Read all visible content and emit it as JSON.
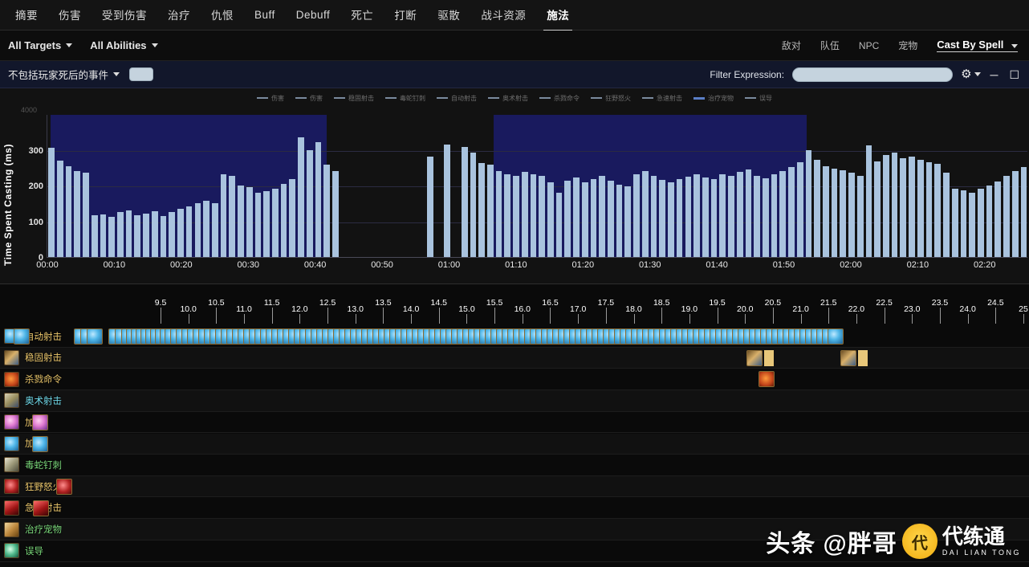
{
  "tabs": [
    {
      "label": "摘要",
      "active": false
    },
    {
      "label": "伤害",
      "active": false
    },
    {
      "label": "受到伤害",
      "active": false
    },
    {
      "label": "治疗",
      "active": false
    },
    {
      "label": "仇恨",
      "active": false
    },
    {
      "label": "Buff",
      "active": false
    },
    {
      "label": "Debuff",
      "active": false
    },
    {
      "label": "死亡",
      "active": false
    },
    {
      "label": "打断",
      "active": false
    },
    {
      "label": "驱散",
      "active": false
    },
    {
      "label": "战斗资源",
      "active": false
    },
    {
      "label": "施法",
      "active": true
    }
  ],
  "filterbar": {
    "targets_dropdown": "All Targets",
    "abilities_dropdown": "All Abilities",
    "right_filters": [
      "敌对",
      "队伍",
      "NPC",
      "宠物"
    ],
    "cast_by": "Cast By Spell"
  },
  "exprbar": {
    "events_dropdown": "不包括玩家死后的事件",
    "filter_label": "Filter Expression:",
    "filter_value": "",
    "filter_placeholder": "",
    "gear_icon": "gear-icon",
    "minimize_icon": "minimize-icon",
    "maximize_icon": "maximize-icon"
  },
  "chart_data": {
    "type": "bar",
    "title": "",
    "xlabel": "",
    "ylabel": "Time Spent Casting (ms)",
    "ylim": [
      0,
      400
    ],
    "yticks": [
      0,
      100,
      200,
      300
    ],
    "ytick_labels": [
      "0",
      "100",
      "200",
      "300"
    ],
    "y_max_label": "4000",
    "grid": true,
    "legend_position": "top",
    "legend": [
      {
        "label": "伤害",
        "color": "#7a8a9e",
        "highlight": false
      },
      {
        "label": "伤害",
        "color": "#7a8a9e",
        "highlight": false
      },
      {
        "label": "稳固射击",
        "color": "#7a8a9e",
        "highlight": false
      },
      {
        "label": "毒蛇钉刺",
        "color": "#7a8a9e",
        "highlight": false
      },
      {
        "label": "自动射击",
        "color": "#7a8a9e",
        "highlight": false
      },
      {
        "label": "奥术射击",
        "color": "#7a8a9e",
        "highlight": false
      },
      {
        "label": "杀戮命令",
        "color": "#7a8a9e",
        "highlight": false
      },
      {
        "label": "狂野怒火",
        "color": "#7a8a9e",
        "highlight": false
      },
      {
        "label": "急速射击",
        "color": "#7a8a9e",
        "highlight": false
      },
      {
        "label": "治疗宠物",
        "color": "#5b7fc7",
        "highlight": true
      },
      {
        "label": "误导",
        "color": "#7a8a9e",
        "highlight": false
      }
    ],
    "xtick_labels": [
      "00:00",
      "00:10",
      "00:20",
      "00:30",
      "00:40",
      "00:50",
      "01:00",
      "01:10",
      "01:20",
      "01:30",
      "01:40",
      "01:50",
      "02:00",
      "02:10",
      "02:20"
    ],
    "selection_bands": [
      {
        "start_pct": 0.3,
        "end_pct": 28.5
      },
      {
        "start_pct": 45.5,
        "end_pct": 77.5
      }
    ],
    "bar_color": "#a9c3de",
    "values": [
      305,
      270,
      255,
      240,
      235,
      118,
      120,
      112,
      125,
      130,
      118,
      122,
      128,
      115,
      126,
      135,
      142,
      150,
      158,
      150,
      232,
      228,
      200,
      195,
      180,
      185,
      192,
      205,
      218,
      335,
      300,
      322,
      258,
      240,
      0,
      0,
      0,
      0,
      0,
      0,
      0,
      0,
      0,
      0,
      282,
      0,
      315,
      0,
      308,
      292,
      262,
      258,
      240,
      232,
      226,
      238,
      232,
      226,
      208,
      180,
      214,
      222,
      210,
      218,
      228,
      214,
      202,
      198,
      232,
      240,
      228,
      215,
      208,
      218,
      225,
      232,
      222,
      218,
      232,
      226,
      238,
      246,
      228,
      220,
      232,
      240,
      252,
      266,
      300,
      272,
      254,
      248,
      242,
      236,
      228,
      312,
      268,
      286,
      292,
      276,
      280,
      272,
      266,
      260,
      236,
      190,
      186,
      180,
      190,
      200,
      212,
      226,
      240,
      252
    ]
  },
  "timeline": {
    "ruler_ticks": [
      "9.5",
      "10.0",
      "10.5",
      "11.0",
      "11.5",
      "12.0",
      "12.5",
      "13.0",
      "13.5",
      "14.0",
      "14.5",
      "15.0",
      "15.5",
      "16.0",
      "16.5",
      "17.0",
      "17.5",
      "18.0",
      "18.5",
      "19.0",
      "19.5",
      "20.0",
      "20.5",
      "21.0",
      "21.5",
      "22.0",
      "22.5",
      "23.0",
      "23.5",
      "24.0",
      "24.5",
      "25"
    ],
    "rows": [
      {
        "name": "自动射击",
        "color": "#e8c46a",
        "icon": "auto-shot-icon",
        "icon_class": "ic-auto",
        "casts": [
          17,
          92,
          100,
          108,
          135,
          143,
          151,
          157,
          163,
          169,
          175,
          181,
          187,
          193,
          199,
          205,
          212,
          219,
          226,
          233,
          240,
          247,
          254,
          261,
          268,
          275,
          282,
          289,
          296,
          303,
          310,
          317,
          324,
          331,
          338,
          345,
          352,
          359,
          366,
          373,
          380,
          387,
          394,
          401,
          408,
          415,
          422,
          429,
          436,
          443,
          450,
          457,
          464,
          471,
          478,
          485,
          492,
          499,
          506,
          513,
          520,
          527,
          534,
          541,
          548,
          555,
          562,
          569,
          576,
          583,
          590,
          597,
          604,
          611,
          618,
          625,
          632,
          639,
          646,
          653,
          660,
          667,
          674,
          681,
          688,
          695,
          702,
          709,
          716,
          723,
          730,
          737,
          744,
          751,
          758,
          765,
          772,
          779,
          786,
          793,
          800,
          807,
          814,
          821,
          828,
          835,
          842,
          849,
          856,
          863,
          870,
          877,
          884,
          891,
          898,
          905,
          912,
          919,
          926,
          933,
          940,
          947,
          954,
          961,
          968,
          975,
          982,
          989,
          996,
          1003,
          1010,
          1017,
          1024,
          1031
        ],
        "bars": []
      },
      {
        "name": "稳固射击",
        "color": "#e8c46a",
        "icon": "steady-shot-icon",
        "icon_class": "ic-steady",
        "casts": [
          930,
          1047
        ],
        "bars": [
          {
            "x": 952,
            "w": 12
          },
          {
            "x": 1069,
            "w": 12
          }
        ]
      },
      {
        "name": "杀戮命令",
        "color": "#e8c46a",
        "icon": "kill-command-icon",
        "icon_class": "ic-kill",
        "casts": [
          945
        ],
        "bars": []
      },
      {
        "name": "奥术射击",
        "color": "#6fd8e8",
        "icon": "arcane-shot-icon",
        "icon_class": "ic-arcane",
        "casts": [],
        "bars": []
      },
      {
        "name": "加速",
        "color": "#e8c46a",
        "icon": "haste-icon",
        "icon_class": "ic-haste1",
        "casts": [
          40
        ],
        "bars": []
      },
      {
        "name": "加速",
        "color": "#e8c46a",
        "icon": "haste-alt-icon",
        "icon_class": "ic-haste2",
        "casts": [
          40
        ],
        "bars": []
      },
      {
        "name": "毒蛇钉刺",
        "color": "#7ad87a",
        "icon": "serpent-sting-icon",
        "icon_class": "ic-serp",
        "casts": [],
        "bars": []
      },
      {
        "name": "狂野怒火",
        "color": "#e8c46a",
        "icon": "bestial-wrath-icon",
        "icon_class": "ic-wrath",
        "casts": [
          70
        ],
        "bars": []
      },
      {
        "name": "急速射击",
        "color": "#e8c46a",
        "icon": "rapid-fire-icon",
        "icon_class": "ic-rapid",
        "casts": [
          41
        ],
        "bars": []
      },
      {
        "name": "治疗宠物",
        "color": "#7ad87a",
        "icon": "mend-pet-icon",
        "icon_class": "ic-mend",
        "casts": [],
        "bars": []
      },
      {
        "name": "误导",
        "color": "#7ad87a",
        "icon": "misdirection-icon",
        "icon_class": "ic-misd",
        "casts": [],
        "bars": []
      }
    ]
  },
  "watermark": {
    "text": "头条 @胖哥",
    "logo_main": "代练通",
    "logo_sub": "DAI LIAN TONG",
    "logo_glyph": "代"
  }
}
